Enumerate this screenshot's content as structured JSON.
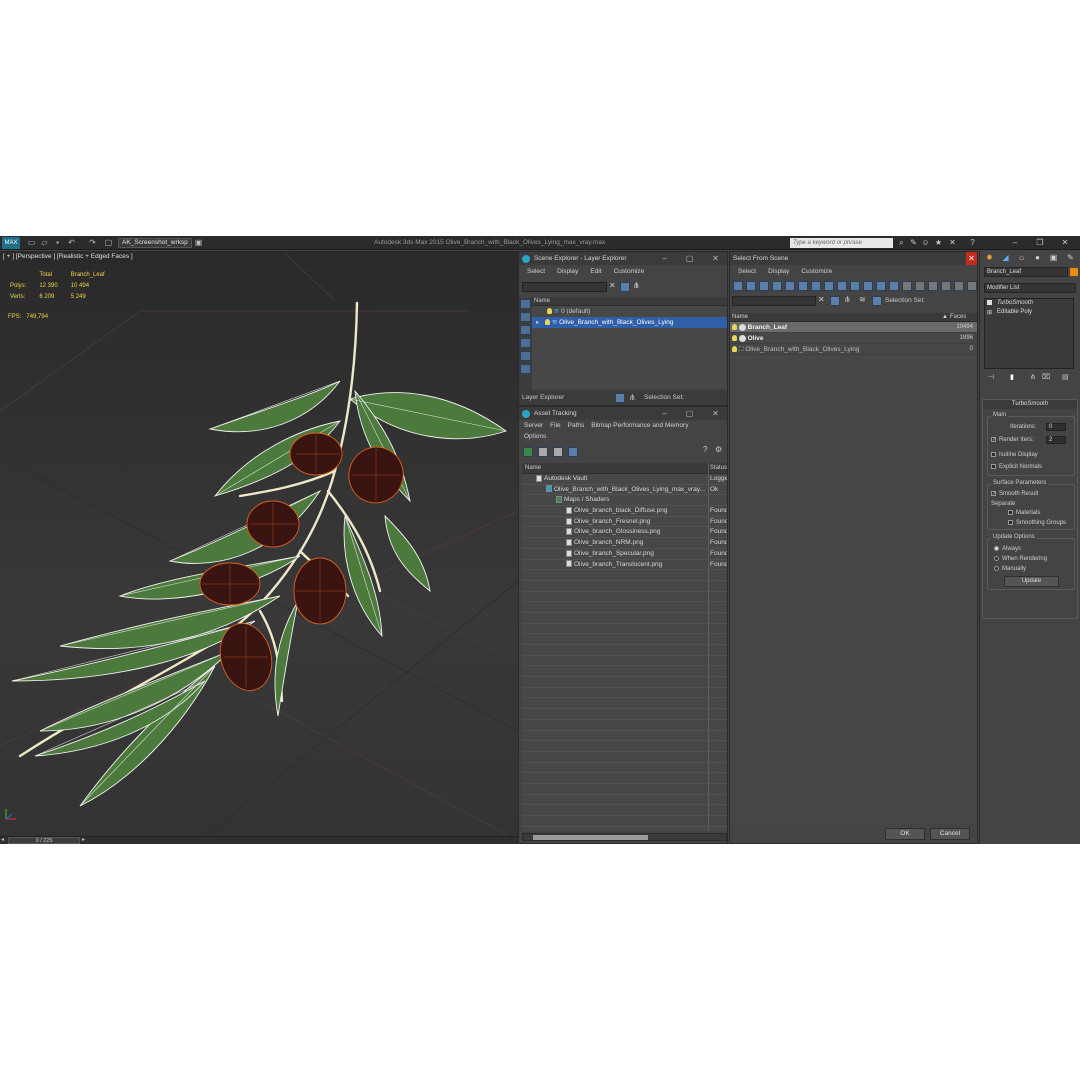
{
  "app": {
    "title": "Autodesk 3ds Max 2015    Olive_Branch_with_Black_Olives_Lying_max_vray.max",
    "workspace": "AK_Screenshot_wrksp",
    "search_placeholder": "Type a keyword or phrase"
  },
  "viewport": {
    "label": "[ + ] [Perspective ] [Realistic + Edged Faces ]",
    "stats": {
      "header_total": "Total",
      "header_object": "Branch_Leaf",
      "polys_label": "Polys:",
      "polys_total": "12 390",
      "polys_object": "10 494",
      "verts_label": "Verts:",
      "verts_total": "6 209",
      "verts_object": "5 249",
      "fps_label": "FPS:",
      "fps_value": "749,794"
    },
    "time_slider": "0 / 225"
  },
  "scene_explorer": {
    "title": "Scene Explorer - Layer Explorer",
    "menu": [
      "Select",
      "Display",
      "Edit",
      "Customize"
    ],
    "column_name": "Name",
    "layers": [
      {
        "name": "0 (default)"
      },
      {
        "name": "Olive_Branch_with_Black_Olives_Lying"
      }
    ],
    "footer_label": "Layer Explorer",
    "selection_set_label": "Selection Set:"
  },
  "asset_tracking": {
    "title": "Asset Tracking",
    "menu": [
      "Server",
      "File",
      "Paths",
      "Bitmap Performance and Memory"
    ],
    "menu2": "Options",
    "col_name": "Name",
    "col_status": "Status",
    "rows": [
      {
        "name": "Autodesk Vault",
        "status": "Logge",
        "indent": 0
      },
      {
        "name": "Olive_Branch_with_Black_Olives_Lying_max_vray...",
        "status": "Ok",
        "indent": 1
      },
      {
        "name": "Maps / Shaders",
        "status": "",
        "indent": 2
      },
      {
        "name": "Olive_branch_black_Diffuse.png",
        "status": "Found",
        "indent": 3
      },
      {
        "name": "Olive_branch_Fresnel.png",
        "status": "Found",
        "indent": 3
      },
      {
        "name": "Olive_branch_Glossiness.png",
        "status": "Found",
        "indent": 3
      },
      {
        "name": "Olive_branch_NRM.png",
        "status": "Found",
        "indent": 3
      },
      {
        "name": "Olive_branch_Specular.png",
        "status": "Found",
        "indent": 3
      },
      {
        "name": "Olive_branch_Translucent.png",
        "status": "Found",
        "indent": 3
      }
    ]
  },
  "select_from_scene": {
    "title": "Select From Scene",
    "menu": [
      "Select",
      "Display",
      "Customize"
    ],
    "selection_set_label": "Selection Set:",
    "col_name": "Name",
    "col_faces": "Faces",
    "rows": [
      {
        "name": "Branch_Leaf",
        "faces": "10494"
      },
      {
        "name": "Olive",
        "faces": "1896"
      },
      {
        "name": "Olive_Branch_with_Black_Olives_Lying",
        "faces": "0"
      }
    ],
    "ok": "OK",
    "cancel": "Cancel"
  },
  "command_panel": {
    "object_name": "Branch_Leaf",
    "modifier_list": "Modifier List",
    "stack": [
      "TurboSmooth",
      "Editable Poly"
    ],
    "rollout_title": "TurboSmooth",
    "main_group": "Main",
    "iterations_label": "Iterations:",
    "iterations_value": "0",
    "render_iters_label": "Render Iters:",
    "render_iters_value": "2",
    "isoline_display": "Isoline Display",
    "explicit_normals": "Explicit Normals",
    "surface_group": "Surface Parameters",
    "smooth_result": "Smooth Result",
    "separate_label": "Separate",
    "materials": "Materials",
    "smoothing_groups": "Smoothing Groups",
    "update_group": "Update Options",
    "always": "Always",
    "when_rendering": "When Rendering",
    "manually": "Manually",
    "update_button": "Update"
  },
  "colors": {
    "selection_blue": "#2f5fa8",
    "stats_yellow": "#f0d44a",
    "leaf_green": "#4c7a3c",
    "olive_dark": "#3a1410",
    "wire_orange": "#d9601e"
  }
}
